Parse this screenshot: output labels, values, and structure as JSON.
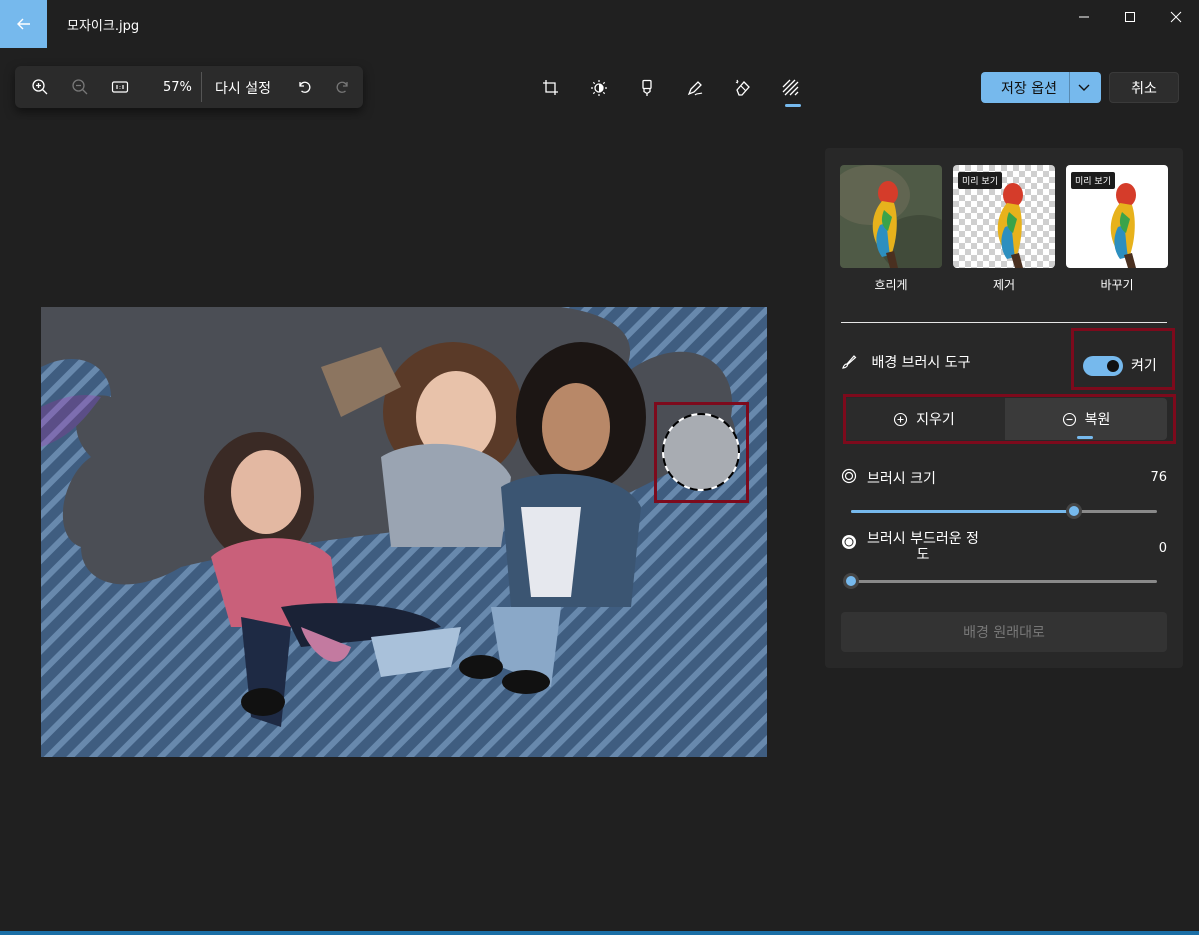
{
  "titlebar": {
    "file_name": "모자이크.jpg"
  },
  "toolbar": {
    "zoom_percent": "57%",
    "reset_label": "다시 설정",
    "save_label": "저장 옵션",
    "cancel_label": "취소"
  },
  "panel": {
    "modes": [
      {
        "label": "흐리게",
        "badge": ""
      },
      {
        "label": "제거",
        "badge": "미리 보기"
      },
      {
        "label": "바꾸기",
        "badge": "미리 보기"
      }
    ],
    "brush_tool_label": "배경 브러시 도구",
    "toggle_label": "켜기",
    "toggle_on": true,
    "erase_label": "지우기",
    "restore_label": "복원",
    "brush_size_label": "브러시 크기",
    "brush_size_value": "76",
    "brush_softness_label_1": "브러시 부드러운 정",
    "brush_softness_label_2": "도",
    "brush_softness_value": "0",
    "reset_background_label": "배경 원래대로"
  },
  "colors": {
    "accent": "#76b9ed",
    "highlight_box": "#7d0a1c",
    "background": "#202020"
  }
}
